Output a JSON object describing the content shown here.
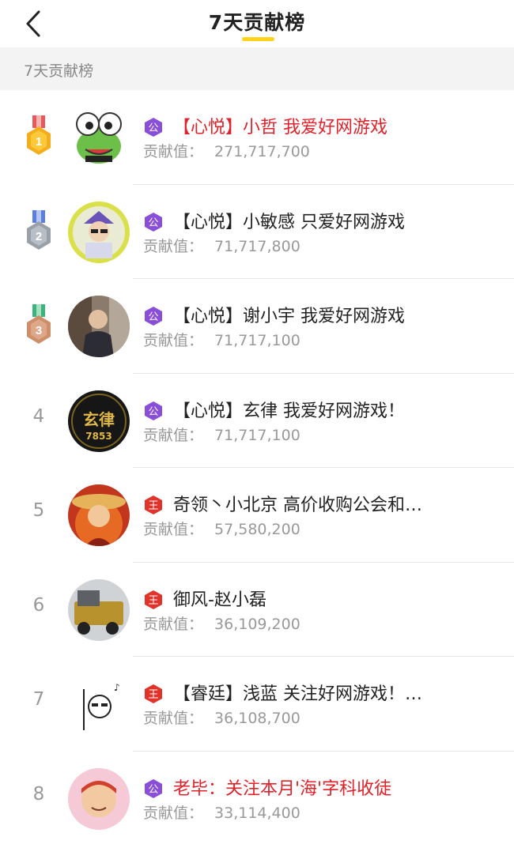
{
  "header": {
    "title": "7天贡献榜"
  },
  "section": {
    "label": "7天贡献榜"
  },
  "contribution_label": "贡献值：",
  "rows": [
    {
      "rank": "1",
      "name": "【心悦】小哲 我爱好网游戏",
      "value": "271,717,700",
      "badge": "公",
      "name_red": true
    },
    {
      "rank": "2",
      "name": "【心悦】小敏感 只爱好网游戏",
      "value": "71,717,800",
      "badge": "公",
      "name_red": false
    },
    {
      "rank": "3",
      "name": "【心悦】谢小宇 我爱好网游戏",
      "value": "71,717,100",
      "badge": "公",
      "name_red": false
    },
    {
      "rank": "4",
      "name": "【心悦】玄律 我爱好网游戏！",
      "value": "71,717,100",
      "badge": "公",
      "name_red": false
    },
    {
      "rank": "5",
      "name": "奇领丶小北京 高价收购公会和…",
      "value": "57,580,200",
      "badge": "王",
      "name_red": false
    },
    {
      "rank": "6",
      "name": "御风-赵小磊",
      "value": "36,109,200",
      "badge": "王",
      "name_red": false
    },
    {
      "rank": "7",
      "name": "【睿廷】浅蓝 关注好网游戏！…",
      "value": "36,108,700",
      "badge": "王",
      "name_red": false
    },
    {
      "rank": "8",
      "name": "老毕：关注本月'海'字科收徒",
      "value": "33,114,400",
      "badge": "公",
      "name_red": true
    }
  ],
  "avatar_art": {
    "4": "玄律",
    "4b": "7853"
  }
}
